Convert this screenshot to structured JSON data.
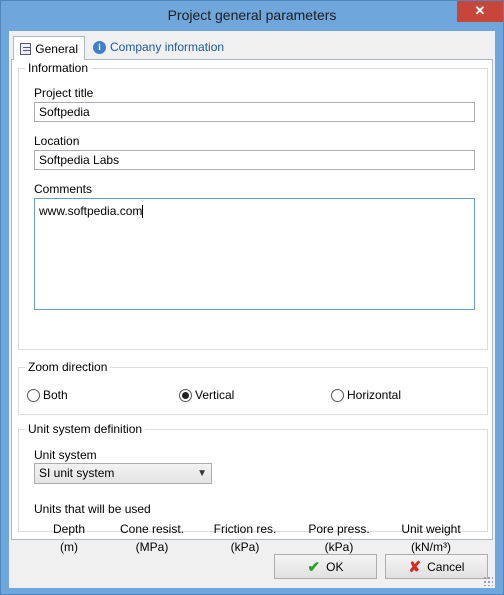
{
  "window": {
    "title": "Project general parameters",
    "close_glyph": "✕"
  },
  "tabs": [
    {
      "label": "General",
      "icon": "form-icon",
      "active": true
    },
    {
      "label": "Company information",
      "icon": "info-icon",
      "active": false
    }
  ],
  "information": {
    "legend": "Information",
    "project_title_label": "Project title",
    "project_title_value": "Softpedia",
    "location_label": "Location",
    "location_value": "Softpedia Labs",
    "comments_label": "Comments",
    "comments_value": "www.softpedia.com"
  },
  "zoom": {
    "legend": "Zoom direction",
    "options": [
      "Both",
      "Vertical",
      "Horizontal"
    ],
    "selected": "Vertical"
  },
  "units": {
    "legend": "Unit system definition",
    "unit_system_label": "Unit system",
    "unit_system_value": "SI unit system",
    "units_used_label": "Units that will be used",
    "columns": [
      {
        "name": "Depth",
        "unit": "(m)"
      },
      {
        "name": "Cone resist.",
        "unit": "(MPa)"
      },
      {
        "name": "Friction res.",
        "unit": "(kPa)"
      },
      {
        "name": "Pore press.",
        "unit": "(kPa)"
      },
      {
        "name": "Unit weight",
        "unit": "(kN/m³)"
      }
    ]
  },
  "buttons": {
    "ok": "OK",
    "cancel": "Cancel"
  },
  "colors": {
    "titlebar": "#6fa7dc",
    "close": "#c7463a",
    "ok_check": "#2e9d2e",
    "cancel_x": "#d82b20"
  }
}
